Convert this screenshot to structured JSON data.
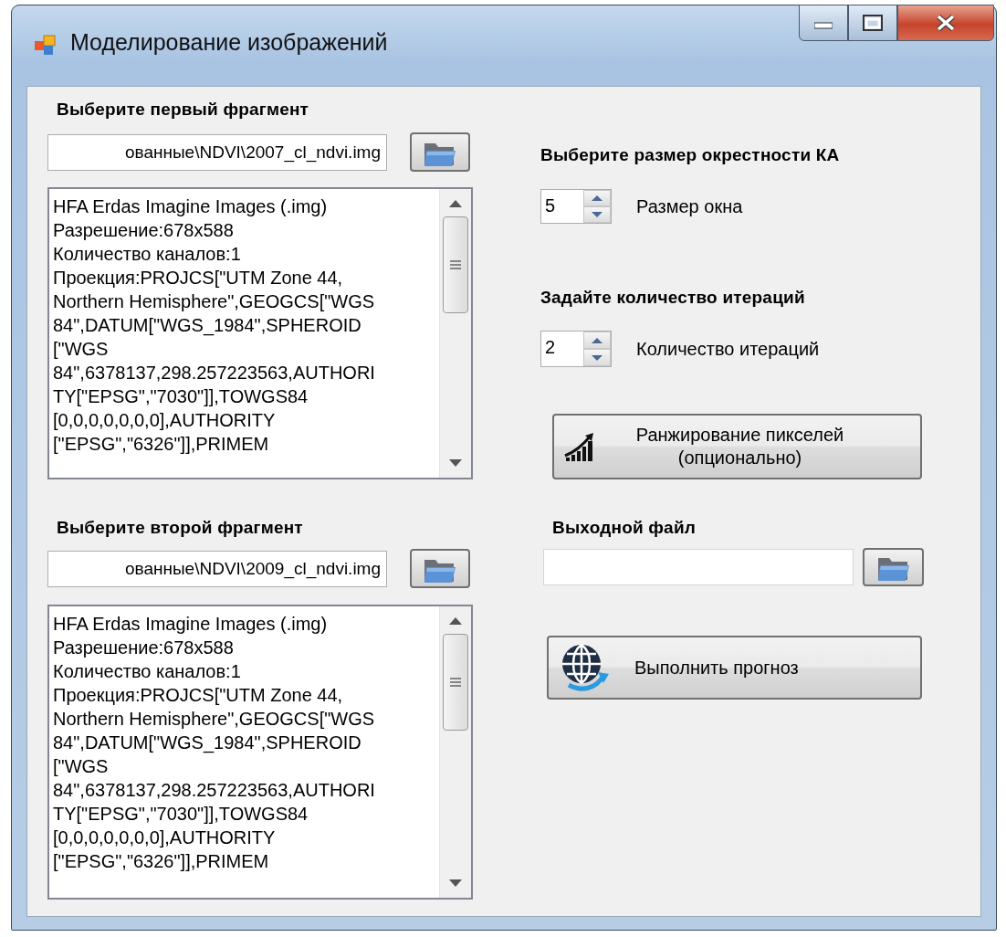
{
  "window": {
    "title": "Моделирование изображений"
  },
  "fragments": [
    {
      "heading": "Выберите первый фрагмент",
      "path": "ованные\\NDVI\\2007_cl_ndvi.img",
      "info_lines": [
        "HFA Erdas Imagine Images (.img)",
        "Разрешение:678x588",
        "Количество каналов:1",
        "Проекция:PROJCS[\"UTM Zone 44,",
        "Northern Hemisphere\",GEOGCS[\"WGS",
        "84\",DATUM[\"WGS_1984\",SPHEROID",
        "[\"WGS",
        "84\",6378137,298.257223563,AUTHORI",
        "TY[\"EPSG\",\"7030\"]],TOWGS84",
        "[0,0,0,0,0,0,0],AUTHORITY",
        "[\"EPSG\",\"6326\"]],PRIMEM"
      ]
    },
    {
      "heading": "Выберите второй фрагмент",
      "path": "ованные\\NDVI\\2009_cl_ndvi.img",
      "info_lines": [
        "HFA Erdas Imagine Images (.img)",
        "Разрешение:678x588",
        "Количество каналов:1",
        "Проекция:PROJCS[\"UTM Zone 44,",
        "Northern Hemisphere\",GEOGCS[\"WGS",
        "84\",DATUM[\"WGS_1984\",SPHEROID",
        "[\"WGS",
        "84\",6378137,298.257223563,AUTHORI",
        "TY[\"EPSG\",\"7030\"]],TOWGS84",
        "[0,0,0,0,0,0,0],AUTHORITY",
        "[\"EPSG\",\"6326\"]],PRIMEM"
      ]
    }
  ],
  "settings": [
    {
      "heading": "Выберите размер окрестности КА",
      "value": "5",
      "label": "Размер окна"
    },
    {
      "heading": "Задайте количество итераций",
      "value": "2",
      "label": "Количество итераций"
    }
  ],
  "rank_button": {
    "lines": [
      "Ранжирование пикселей",
      "(опционально)"
    ]
  },
  "output": {
    "heading": "Выходной файл"
  },
  "run_button": {
    "label": "Выполнить прогноз"
  }
}
